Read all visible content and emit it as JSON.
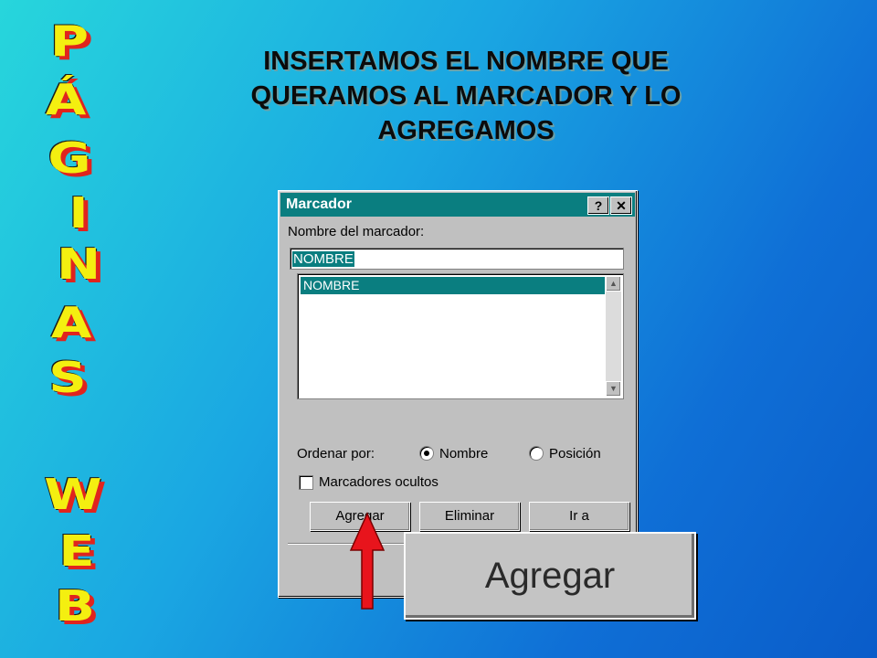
{
  "slide": {
    "title_lines": [
      "INSERTAMOS EL NOMBRE QUE",
      "QUERAMOS AL MARCADOR Y LO",
      "AGREGAMOS"
    ],
    "side_letters": [
      "P",
      "Á",
      "G",
      "I",
      "N",
      "A",
      "S",
      "W",
      "E",
      "B"
    ]
  },
  "dialog": {
    "title": "Marcador",
    "help_label": "?",
    "close_label": "✕",
    "name_label": "Nombre del marcador:",
    "name_value": "NOMBRE",
    "list_items": [
      "NOMBRE"
    ],
    "sort_label": "Ordenar por:",
    "sort_options": [
      {
        "label": "Nombre",
        "selected": true
      },
      {
        "label": "Posición",
        "selected": false
      }
    ],
    "hidden_label": "Marcadores ocultos",
    "buttons": {
      "add": "Agregar",
      "delete": "Eliminar",
      "goto": "Ir a"
    }
  },
  "zoom_label": "Agregar",
  "colors": {
    "titlebar": "#0a7e80",
    "selection": "#0a7e80",
    "arrow": "#e8141c",
    "side_text": "#f4ef10",
    "side_shadow": "#e0241e"
  }
}
